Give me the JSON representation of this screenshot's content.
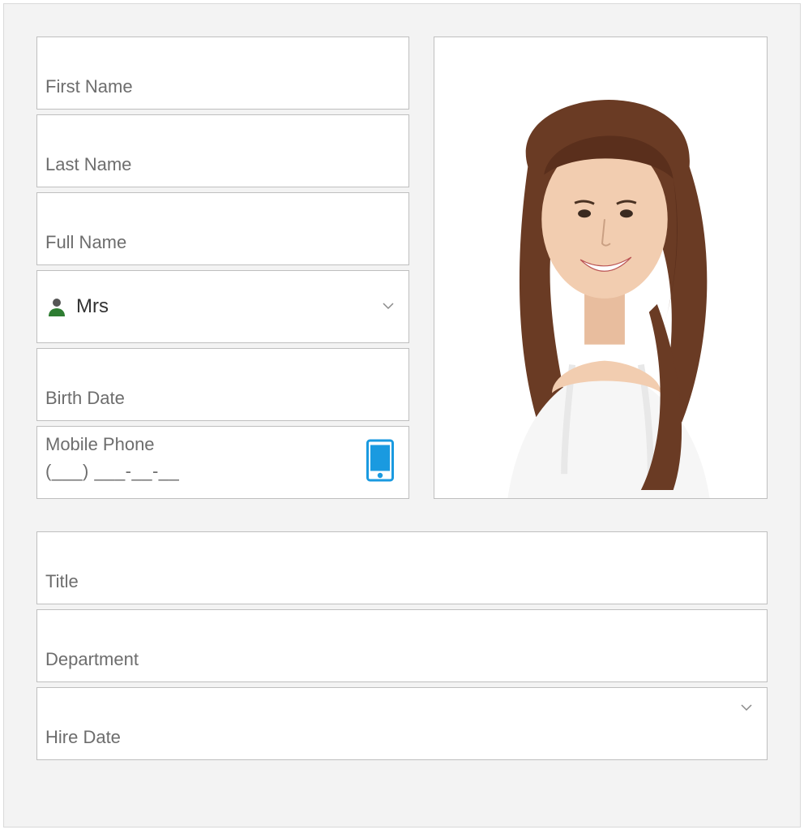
{
  "fields": {
    "first_name": {
      "label": "First Name",
      "value": ""
    },
    "last_name": {
      "label": "Last Name",
      "value": ""
    },
    "full_name": {
      "label": "Full Name",
      "value": ""
    },
    "prefix": {
      "value": "Mrs"
    },
    "birth_date": {
      "label": "Birth Date",
      "value": ""
    },
    "mobile_phone": {
      "label": "Mobile Phone",
      "mask": "(___) ___-__-__",
      "value": ""
    },
    "title": {
      "label": "Title",
      "value": ""
    },
    "department": {
      "label": "Department",
      "value": ""
    },
    "hire_date": {
      "label": "Hire Date",
      "value": ""
    }
  },
  "colors": {
    "border": "#bfbfbf",
    "panel_bg": "#f3f3f3",
    "label": "#6d6d6d",
    "accent_phone": "#1a9ae0",
    "person_icon_body": "#2e7d32",
    "person_icon_head": "#555555"
  }
}
